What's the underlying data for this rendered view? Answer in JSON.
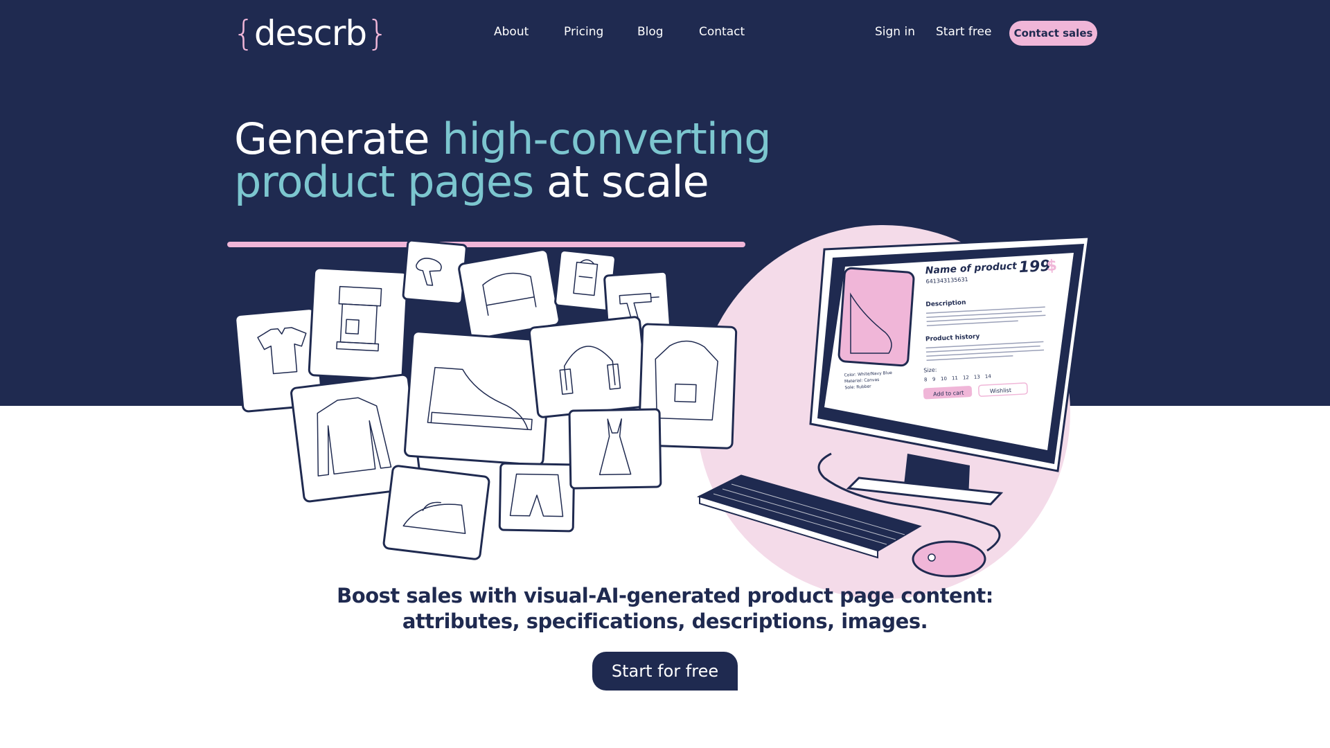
{
  "brand": {
    "logo_open": "{",
    "logo_text": "descrb",
    "logo_close": "}"
  },
  "nav": {
    "items": [
      {
        "label": "About"
      },
      {
        "label": "Pricing"
      },
      {
        "label": "Blog"
      },
      {
        "label": "Contact"
      }
    ],
    "sign_in": "Sign in",
    "start_free": "Start free",
    "contact_sales": "Contact sales"
  },
  "hero": {
    "title_part1": "Generate ",
    "title_accent1": "high-converting",
    "title_accent2": "product pages",
    "title_part2": " at scale",
    "tagline_line1": "Boost sales with visual-AI-generated product page content:",
    "tagline_line2": "attributes, specifications, descriptions, images.",
    "cta": "Start for free"
  },
  "mockup": {
    "product_name": "Name of product",
    "sku": "641343135631",
    "price": "199",
    "currency": "$",
    "description_label": "Description",
    "history_label": "Product history",
    "size_label": "Size:",
    "sizes": [
      "8",
      "9",
      "10",
      "11",
      "12",
      "13",
      "14"
    ],
    "specs": [
      "Color: White/Navy Blue",
      "Material: Canvas",
      "Sole: Rubber"
    ],
    "add_to_cart": "Add to cart",
    "wishlist": "Wishlist"
  },
  "colors": {
    "navy": "#1f2a50",
    "pink": "#f0b6d8",
    "teal": "#7cc6cf",
    "light_pink": "#f4dbe9"
  },
  "icons": [
    "shirt-icon",
    "coffee-machine-icon",
    "hair-dryer-icon",
    "armchair-icon",
    "backpack-icon",
    "drill-icon",
    "sweater-icon",
    "sneaker-icon",
    "headphones-icon",
    "hoodie-icon",
    "iron-icon",
    "shorts-icon",
    "dress-icon"
  ]
}
